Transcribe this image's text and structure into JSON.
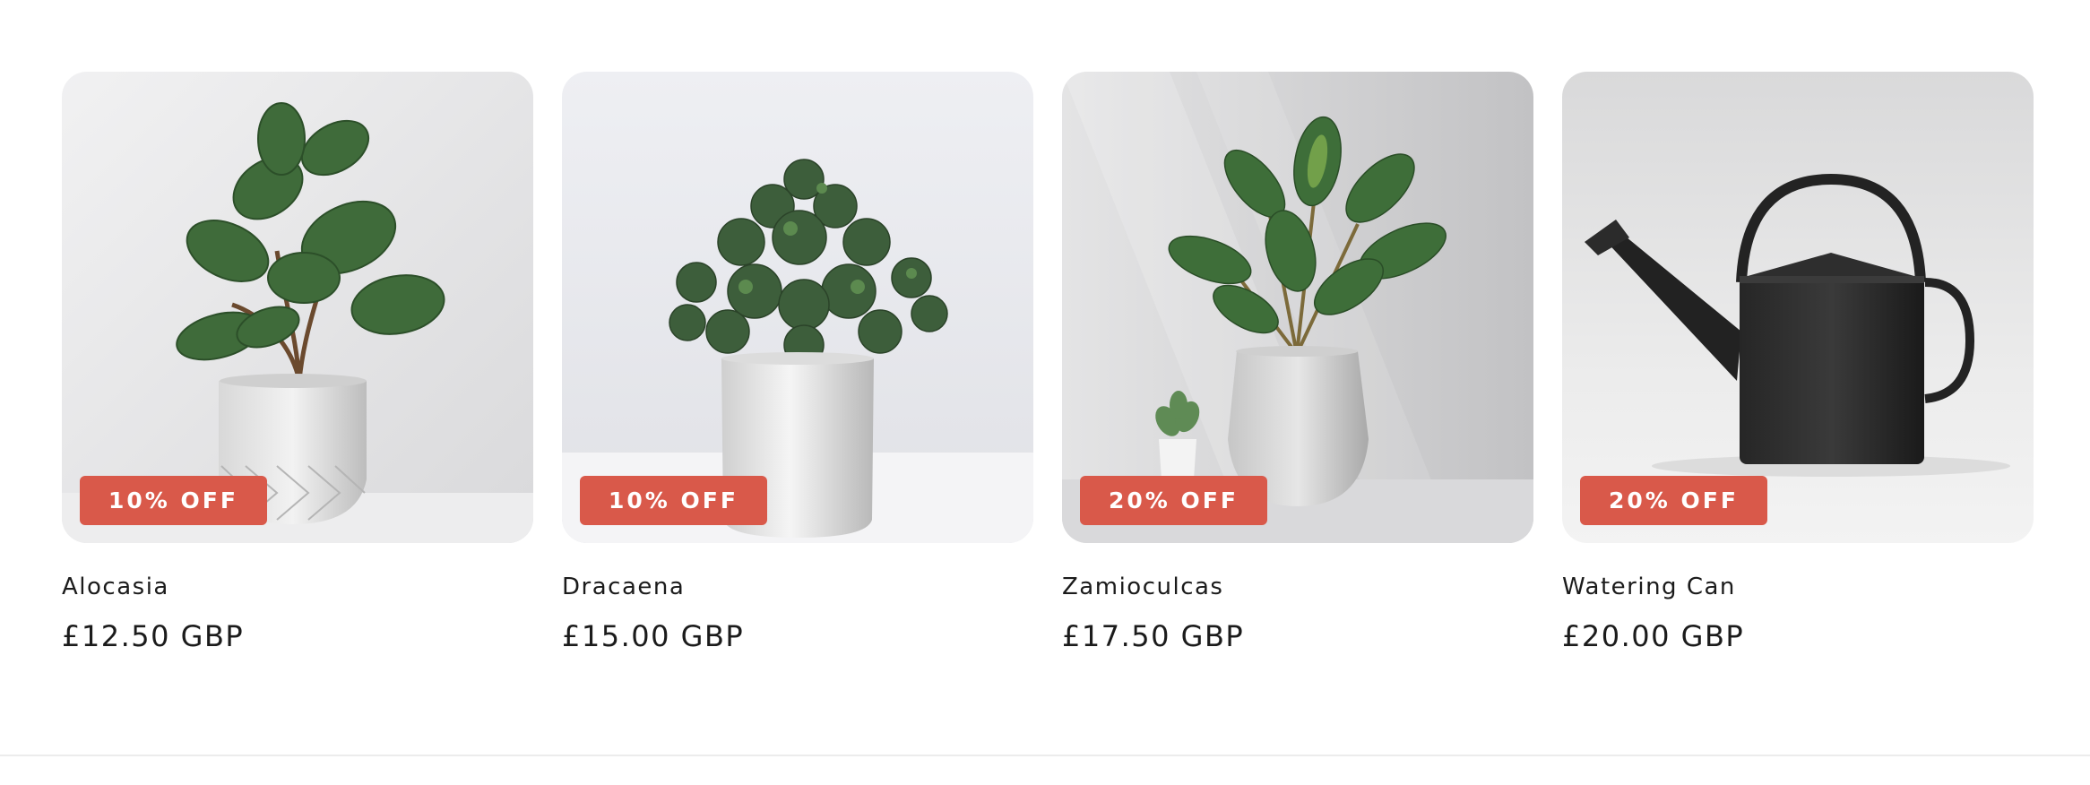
{
  "products": [
    {
      "title": "Alocasia",
      "price": "£12.50 GBP",
      "badge": "10% OFF",
      "image_icon": "plant-in-pot-image"
    },
    {
      "title": "Dracaena",
      "price": "£15.00 GBP",
      "badge": "10% OFF",
      "image_icon": "succulent-in-pot-image"
    },
    {
      "title": "Zamioculcas",
      "price": "£17.50 GBP",
      "badge": "20% OFF",
      "image_icon": "plant-in-tall-pot-image"
    },
    {
      "title": "Watering Can",
      "price": "£20.00 GBP",
      "badge": "20% OFF",
      "image_icon": "watering-can-image"
    }
  ],
  "colors": {
    "badge_bg": "#d9594a",
    "badge_text": "#ffffff",
    "text": "#1b1b1b",
    "divider": "#ececec"
  }
}
